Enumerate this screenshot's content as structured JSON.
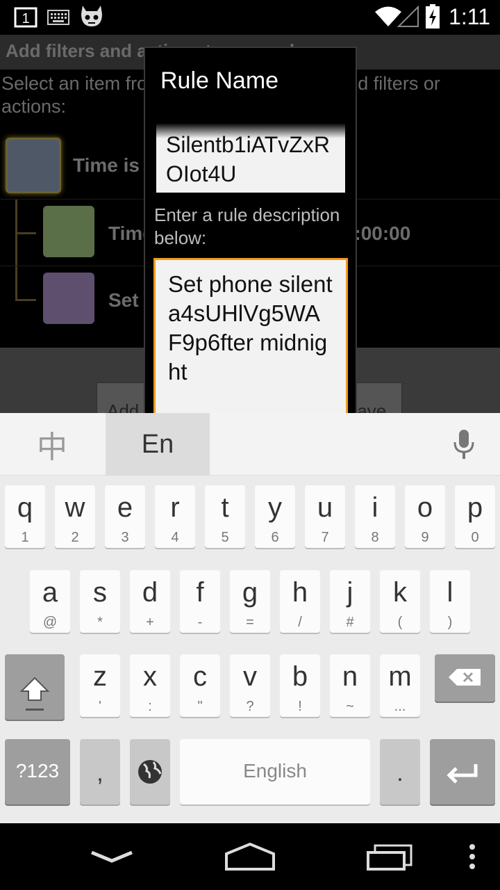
{
  "status_bar": {
    "time": "1:11",
    "icons": [
      "notification-1-icon",
      "keyboard-icon",
      "cyanogen-mascot-icon",
      "wifi-icon",
      "signal-icon",
      "battery-charging-icon"
    ],
    "notification_number": "1"
  },
  "background_app": {
    "title": "Add filters and actions to your rule",
    "instructions": "Select an item from the tree below, then add filters or actions:",
    "tree": {
      "root_label": "Time is",
      "child_1_label": "Time is after 1970-01-01 00:00:00",
      "child_2_label": "Set phone silent"
    },
    "buttons": {
      "add_label": "Add filter",
      "save_label": "Save"
    },
    "colors": {
      "root_square": "#4f5866",
      "child_1_square": "#5a6e48",
      "child_2_square": "#5e4f6e"
    }
  },
  "dialog": {
    "title": "Rule Name",
    "name_value": "Silentb1iATvZxROIot4U",
    "description_label": "Enter a rule description below:",
    "description_value": "Set phone silent a4sUHlVg5WAF9p6fter midnight",
    "accent_color": "#f39a1c"
  },
  "keyboard": {
    "lang_cn": "中",
    "lang_en": "En",
    "row1": [
      {
        "k": "q",
        "s": "1"
      },
      {
        "k": "w",
        "s": "2"
      },
      {
        "k": "e",
        "s": "3"
      },
      {
        "k": "r",
        "s": "4"
      },
      {
        "k": "t",
        "s": "5"
      },
      {
        "k": "y",
        "s": "6"
      },
      {
        "k": "u",
        "s": "7"
      },
      {
        "k": "i",
        "s": "8"
      },
      {
        "k": "o",
        "s": "9"
      },
      {
        "k": "p",
        "s": "0"
      }
    ],
    "row2": [
      {
        "k": "a",
        "s": "@"
      },
      {
        "k": "s",
        "s": "*"
      },
      {
        "k": "d",
        "s": "+"
      },
      {
        "k": "f",
        "s": "-"
      },
      {
        "k": "g",
        "s": "="
      },
      {
        "k": "h",
        "s": "/"
      },
      {
        "k": "j",
        "s": "#"
      },
      {
        "k": "k",
        "s": "("
      },
      {
        "k": "l",
        "s": ")"
      }
    ],
    "row3": [
      {
        "k": "z",
        "s": "'"
      },
      {
        "k": "x",
        "s": ":"
      },
      {
        "k": "c",
        "s": "\""
      },
      {
        "k": "v",
        "s": "?"
      },
      {
        "k": "b",
        "s": "!"
      },
      {
        "k": "n",
        "s": "~"
      },
      {
        "k": "m",
        "s": "..."
      }
    ],
    "symbols_label": "?123",
    "comma_label": ",",
    "space_label": "English",
    "period_label": "."
  },
  "nav_bar": {
    "icons": [
      "back-icon",
      "home-icon",
      "recents-icon",
      "menu-icon"
    ]
  }
}
